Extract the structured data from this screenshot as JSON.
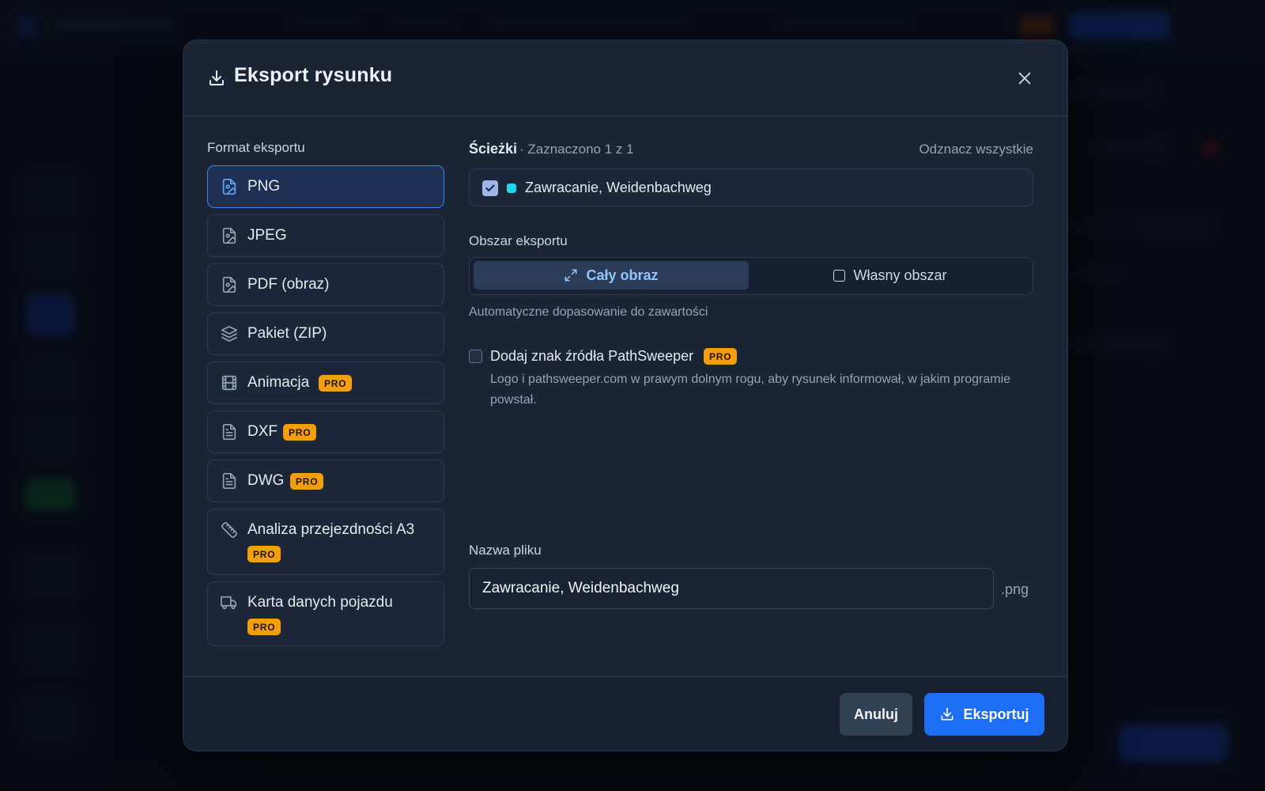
{
  "dialog": {
    "title": "Eksport rysunku"
  },
  "formats": {
    "section_label": "Format eksportu",
    "items": [
      {
        "label": "PNG",
        "icon": "file-image-icon",
        "pro": false,
        "selected": true
      },
      {
        "label": "JPEG",
        "icon": "file-image-icon",
        "pro": false,
        "selected": false
      },
      {
        "label": "PDF (obraz)",
        "icon": "file-image-icon",
        "pro": false,
        "selected": false
      },
      {
        "label": "Pakiet (ZIP)",
        "icon": "layers-icon",
        "pro": false,
        "selected": false
      },
      {
        "label": "Animacja",
        "icon": "film-icon",
        "pro": true,
        "selected": false
      },
      {
        "label": "DXF",
        "icon": "file-text-icon",
        "pro": true,
        "selected": false
      },
      {
        "label": "DWG",
        "icon": "file-text-icon",
        "pro": true,
        "selected": false
      },
      {
        "label": "Analiza przejezdności A3",
        "icon": "ruler-icon",
        "pro": true,
        "selected": false
      },
      {
        "label": "Karta danych pojazdu",
        "icon": "truck-icon",
        "pro": true,
        "selected": false
      }
    ],
    "pro_badge": "PRO"
  },
  "paths": {
    "title": "Ścieżki",
    "count_text": "· Zaznaczono 1 z 1",
    "deselect_label": "Odznacz wszystkie",
    "items": [
      {
        "name": "Zawracanie, Weidenbachweg",
        "checked": true,
        "color": "#22d3ee"
      }
    ]
  },
  "area": {
    "label": "Obszar eksportu",
    "options": [
      {
        "label": "Cały obraz",
        "icon": "expand-icon",
        "selected": true
      },
      {
        "label": "Własny obszar",
        "icon": "square-icon",
        "selected": false
      }
    ],
    "hint": "Automatyczne dopasowanie do zawartości"
  },
  "watermark": {
    "label": "Dodaj znak źródła PathSweeper",
    "pro_badge": "PRO",
    "checked": false,
    "description": "Logo i pathsweeper.com w prawym dolnym rogu, aby rysunek informował, w jakim programie powstał."
  },
  "filename": {
    "label": "Nazwa pliku",
    "value": "Zawracanie, Weidenbachweg",
    "extension": ".png"
  },
  "footer": {
    "cancel_label": "Anuluj",
    "export_label": "Eksportuj"
  },
  "colors": {
    "accent": "#1d6ef5",
    "pro": "#f59e0b",
    "modal_bg": "#1b2536"
  }
}
